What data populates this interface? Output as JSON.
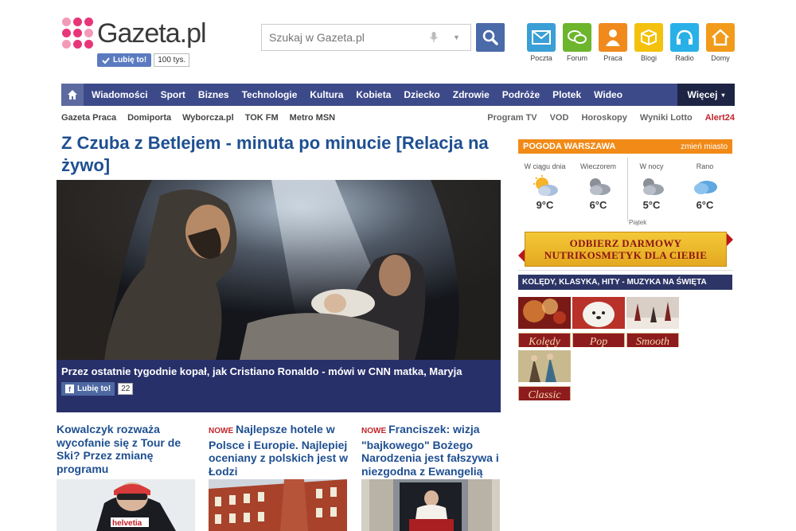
{
  "brand": {
    "logo_text": "Gazeta.pl",
    "like_label": "Lubię to!",
    "like_count": "100 tys."
  },
  "search": {
    "placeholder": "Szukaj w Gazeta.pl"
  },
  "quick_links": [
    {
      "label": "Poczta",
      "icon": "mail-icon",
      "color": "#3a9fd6"
    },
    {
      "label": "Forum",
      "icon": "chat-icon",
      "color": "#6cb52d"
    },
    {
      "label": "Praca",
      "icon": "person-icon",
      "color": "#f08a1c"
    },
    {
      "label": "Blogi",
      "icon": "box-icon",
      "color": "#f4c20d"
    },
    {
      "label": "Radio",
      "icon": "headphones-icon",
      "color": "#2ab0e8"
    },
    {
      "label": "Domy",
      "icon": "house-icon",
      "color": "#f29a1a"
    }
  ],
  "nav": {
    "items": [
      "Wiadomości",
      "Sport",
      "Biznes",
      "Technologie",
      "Kultura",
      "Kobieta",
      "Dziecko",
      "Zdrowie",
      "Podróże",
      "Plotek",
      "Wideo"
    ],
    "more": "Więcej",
    "color": "#3d4a8a"
  },
  "subnav": {
    "left": [
      "Gazeta Praca",
      "Domiporta",
      "Wyborcza.pl",
      "TOK FM",
      "Metro MSN"
    ],
    "right": [
      "Program TV",
      "VOD",
      "Horoskopy",
      "Wyniki Lotto"
    ],
    "alert": "Alert24"
  },
  "main": {
    "headline": "Z Czuba z Betlejem - minuta po minucie [Relacja na żywo]",
    "hero_caption": "Przez ostatnie tygodnie kopał, jak Cristiano Ronaldo - mówi w CNN matka, Maryja",
    "fb_like": "Lubię to!",
    "fb_count": "22"
  },
  "teasers": [
    {
      "badge": "",
      "title": "Kowalczyk rozważa wycofanie się z Tour de Ski? Przez zmianę programu"
    },
    {
      "badge": "NOWE",
      "title": "Najlepsze hotele w Polsce i Europie. Najlepiej oceniany z polskich jest w Łodzi"
    },
    {
      "badge": "NOWE",
      "title": "Franciszek: wizja \"bajkowego\" Bożego Narodzenia jest fałszywa i niezgodna z Ewangelią"
    }
  ],
  "weather": {
    "title": "POGODA WARSZAWA",
    "change": "zmień miasto",
    "periods": [
      {
        "label": "W ciągu dnia",
        "temp": "9°C",
        "icon": "sun-cloud-icon"
      },
      {
        "label": "Wieczorem",
        "temp": "6°C",
        "icon": "cloud-icon"
      },
      {
        "label": "W nocy",
        "temp": "5°C",
        "icon": "cloud-icon"
      },
      {
        "label": "Rano",
        "temp": "6°C",
        "icon": "blue-cloud-icon"
      }
    ],
    "day_note": "Piątek"
  },
  "promo": {
    "line1": "ODBIERZ DARMOWY",
    "line2": "NUTRIKOSMETYK DLA CIEBIE"
  },
  "music": {
    "title": "KOLĘDY, KLASYKA, HITY - MUZYKA NA ŚWIĘTA",
    "tiles": [
      "Kolędy",
      "Pop",
      "Smooth",
      "Classic"
    ]
  }
}
